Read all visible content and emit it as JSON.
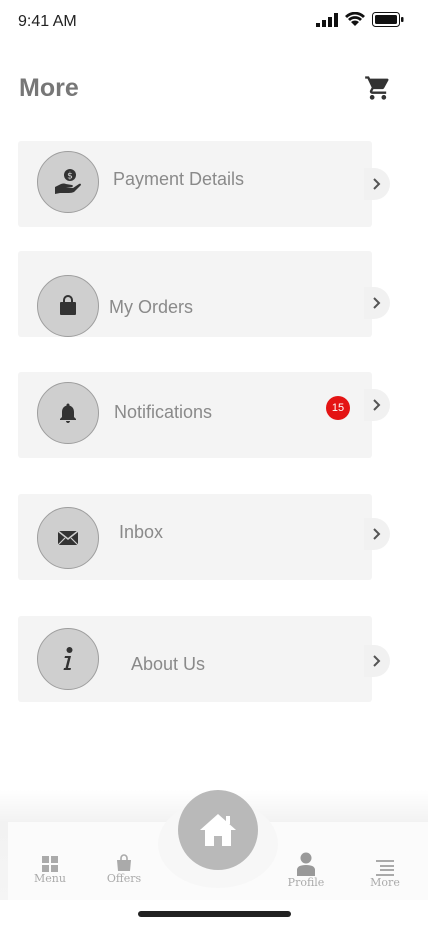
{
  "status_bar": {
    "time": "9:41 AM"
  },
  "header": {
    "title": "More"
  },
  "menu_items": [
    {
      "label": "Payment Details",
      "icon": "hand-coin-icon"
    },
    {
      "label": "My Orders",
      "icon": "shopping-bag-icon"
    },
    {
      "label": "Notifications",
      "icon": "bell-icon",
      "badge": "15"
    },
    {
      "label": "Inbox",
      "icon": "envelope-icon"
    },
    {
      "label": "About Us",
      "icon": "info-icon"
    }
  ],
  "tab_bar": {
    "tabs": [
      {
        "label": "Menu",
        "icon": "grid-icon"
      },
      {
        "label": "Offers",
        "icon": "bag-icon"
      },
      {
        "label": "Profile",
        "icon": "person-icon"
      },
      {
        "label": "More",
        "icon": "list-icon"
      }
    ],
    "home_icon": "home-icon"
  },
  "colors": {
    "badge": "#e41414",
    "card": "#f4f4f4",
    "icon_circle": "#cfcfcf"
  }
}
